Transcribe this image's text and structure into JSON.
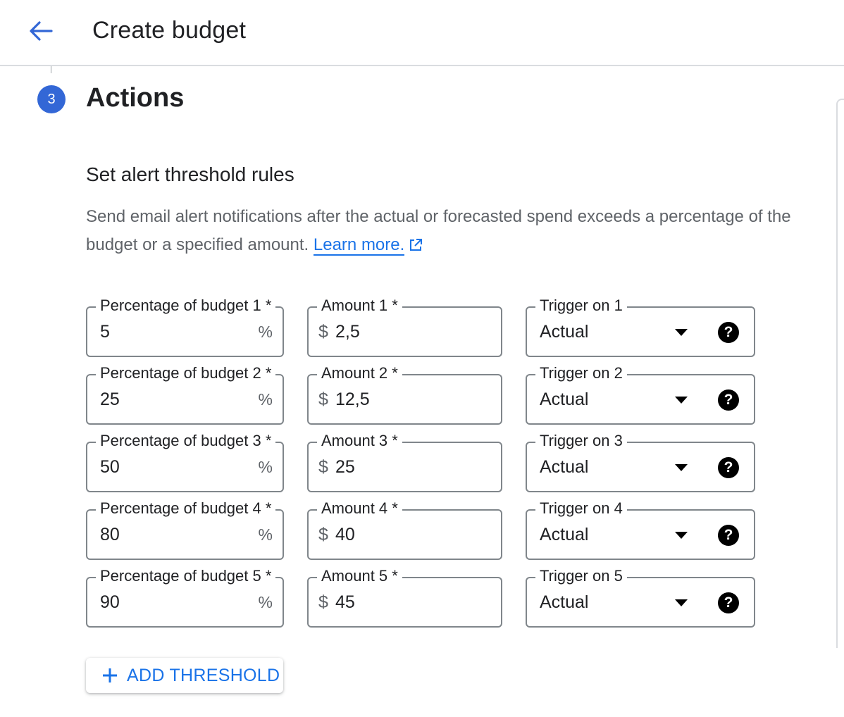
{
  "header": {
    "title": "Create budget",
    "back_icon": "arrow-back-icon"
  },
  "step": {
    "number": "3",
    "title": "Actions"
  },
  "section": {
    "title": "Set alert threshold rules",
    "description": "Send email alert notifications after the actual or forecasted spend exceeds a percentage of the budget or a specified amount.",
    "learn_more": "Learn more.",
    "learn_more_icon": "external-link-icon"
  },
  "thresholds": [
    {
      "pct_label": "Percentage of budget 1 *",
      "pct_value": "5",
      "pct_suffix": "%",
      "amt_label": "Amount 1 *",
      "amt_prefix": "$",
      "amt_value": "2,5",
      "trigger_label": "Trigger on 1",
      "trigger_value": "Actual"
    },
    {
      "pct_label": "Percentage of budget 2 *",
      "pct_value": "25",
      "pct_suffix": "%",
      "amt_label": "Amount 2 *",
      "amt_prefix": "$",
      "amt_value": "12,5",
      "trigger_label": "Trigger on 2",
      "trigger_value": "Actual"
    },
    {
      "pct_label": "Percentage of budget 3 *",
      "pct_value": "50",
      "pct_suffix": "%",
      "amt_label": "Amount 3 *",
      "amt_prefix": "$",
      "amt_value": "25",
      "trigger_label": "Trigger on 3",
      "trigger_value": "Actual"
    },
    {
      "pct_label": "Percentage of budget 4 *",
      "pct_value": "80",
      "pct_suffix": "%",
      "amt_label": "Amount 4 *",
      "amt_prefix": "$",
      "amt_value": "40",
      "trigger_label": "Trigger on 4",
      "trigger_value": "Actual"
    },
    {
      "pct_label": "Percentage of budget 5 *",
      "pct_value": "90",
      "pct_suffix": "%",
      "amt_label": "Amount 5 *",
      "amt_prefix": "$",
      "amt_value": "45",
      "trigger_label": "Trigger on 5",
      "trigger_value": "Actual"
    }
  ],
  "add_threshold": {
    "label": "ADD THRESHOLD",
    "icon": "plus-icon"
  },
  "colors": {
    "accent": "#1a73e8",
    "step_badge": "#3367d6",
    "border": "#80868b"
  }
}
